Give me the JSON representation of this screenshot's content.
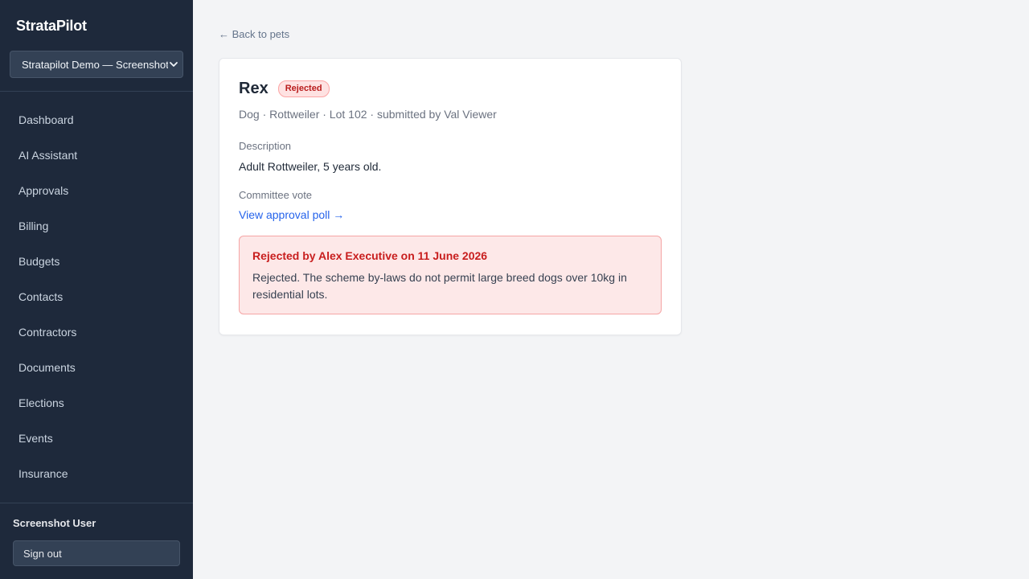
{
  "sidebar": {
    "brand": "StrataPilot",
    "org_select": "Stratapilot Demo — Screenshots",
    "nav": [
      {
        "label": "Dashboard"
      },
      {
        "label": "AI Assistant"
      },
      {
        "label": "Approvals"
      },
      {
        "label": "Billing"
      },
      {
        "label": "Budgets"
      },
      {
        "label": "Contacts"
      },
      {
        "label": "Contractors"
      },
      {
        "label": "Documents"
      },
      {
        "label": "Elections"
      },
      {
        "label": "Events"
      },
      {
        "label": "Insurance"
      }
    ],
    "user_name": "Screenshot User",
    "sign_out": "Sign out"
  },
  "main": {
    "back_link": "← Back to pets",
    "pet": {
      "name": "Rex",
      "status": "Rejected",
      "meta": "Dog · Rottweiler · Lot 102 · submitted by Val Viewer",
      "description_label": "Description",
      "description": "Adult Rottweiler, 5 years old.",
      "vote_label": "Committee vote",
      "poll_link": "View approval poll →"
    },
    "rejection": {
      "title": "Rejected by Alex Executive on 11 June 2026",
      "text": "Rejected. The scheme by-laws do not permit large breed dogs over 10kg in residential lots."
    }
  },
  "colors": {
    "sidebar_bg": "#1e293b",
    "page_bg": "#f3f4f6",
    "link": "#2563eb",
    "danger": "#c81e1e",
    "danger_bg": "#fde8e8"
  }
}
